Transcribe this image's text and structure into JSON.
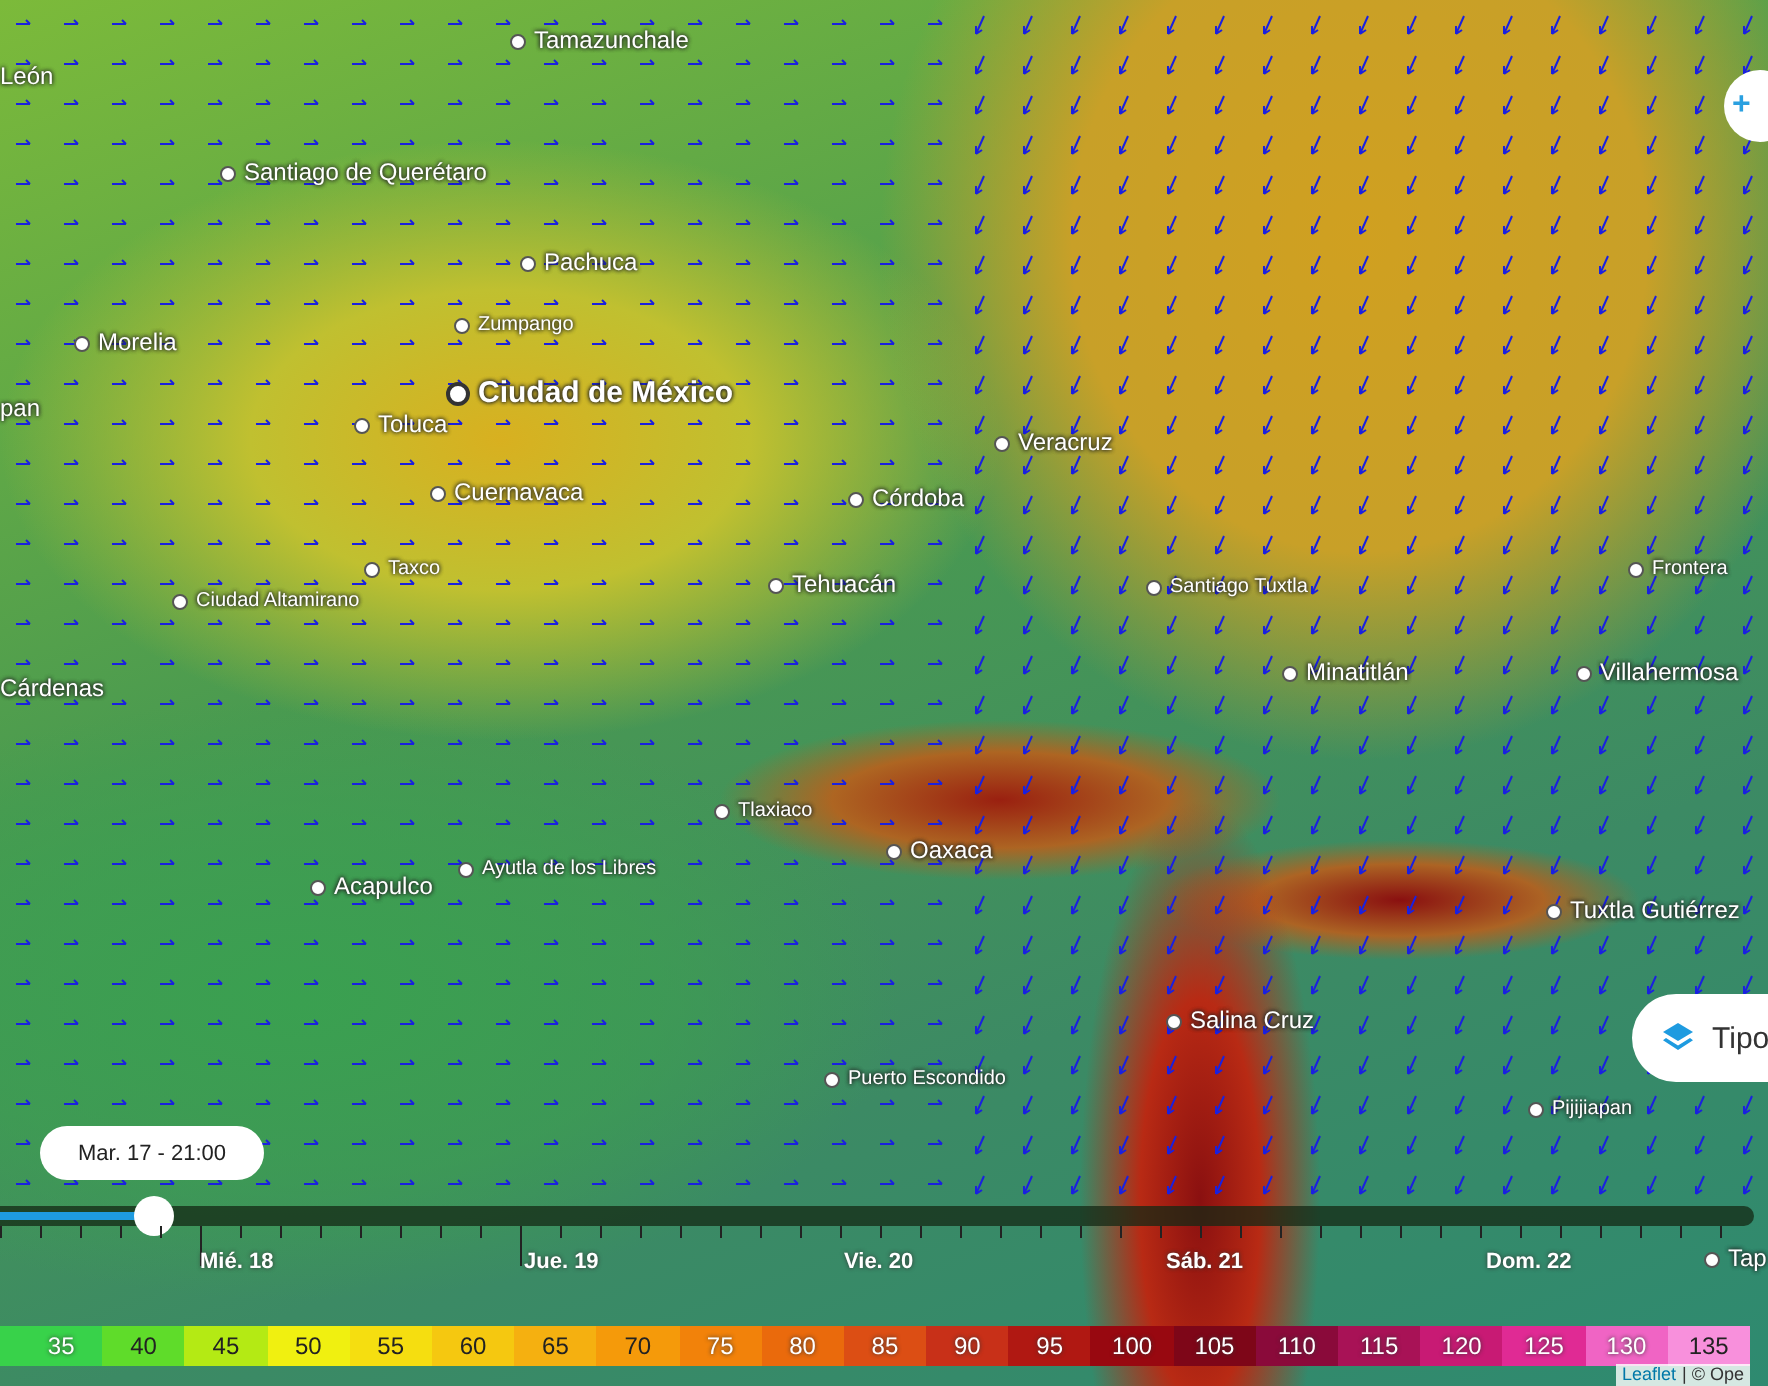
{
  "cities": [
    {
      "name": "León",
      "kind": "label"
    },
    {
      "name": "Tamazunchale",
      "kind": "town"
    },
    {
      "name": "Santiago de Querétaro",
      "kind": "town"
    },
    {
      "name": "Pachuca",
      "kind": "town"
    },
    {
      "name": "Zumpango",
      "kind": "small"
    },
    {
      "name": "Morelia",
      "kind": "town"
    },
    {
      "name": "pan",
      "kind": "label"
    },
    {
      "name": "Ciudad de México",
      "kind": "capital"
    },
    {
      "name": "Toluca",
      "kind": "town"
    },
    {
      "name": "Cuernavaca",
      "kind": "town"
    },
    {
      "name": "Taxco",
      "kind": "small"
    },
    {
      "name": "Ciudad Altamirano",
      "kind": "small"
    },
    {
      "name": "Cárdenas",
      "kind": "label"
    },
    {
      "name": "Córdoba",
      "kind": "town"
    },
    {
      "name": "Veracruz",
      "kind": "town"
    },
    {
      "name": "Tehuacán",
      "kind": "town"
    },
    {
      "name": "Santiago Tuxtla",
      "kind": "small"
    },
    {
      "name": "Frontera",
      "kind": "small"
    },
    {
      "name": "Minatitlán",
      "kind": "town"
    },
    {
      "name": "Villahermosa",
      "kind": "town"
    },
    {
      "name": "Tlaxiaco",
      "kind": "small"
    },
    {
      "name": "Oaxaca",
      "kind": "town"
    },
    {
      "name": "Acapulco",
      "kind": "town"
    },
    {
      "name": "Ayutla de los Libres",
      "kind": "small"
    },
    {
      "name": "Tuxtla Gutiérrez",
      "kind": "town"
    },
    {
      "name": "Salina Cruz",
      "kind": "town"
    },
    {
      "name": "Puerto Escondido",
      "kind": "small"
    },
    {
      "name": "Pijijiapan",
      "kind": "small"
    },
    {
      "name": "Tap",
      "kind": "town"
    }
  ],
  "zoom_button": "+",
  "layer_button": {
    "label": "Tipo"
  },
  "time_badge": "Mar. 17 - 21:00",
  "timeline": {
    "level": 0.088,
    "days": [
      "Mié. 18",
      "Jue. 19",
      "Vie. 20",
      "Sáb. 21",
      "Dom. 22"
    ]
  },
  "legend": [
    {
      "label": "35",
      "color": "#38d24a"
    },
    {
      "label": "40",
      "color": "#5fdc2a"
    },
    {
      "label": "45",
      "color": "#b4ea14"
    },
    {
      "label": "50",
      "color": "#f0f010"
    },
    {
      "label": "55",
      "color": "#f5de10"
    },
    {
      "label": "60",
      "color": "#f5c810"
    },
    {
      "label": "65",
      "color": "#f5b010"
    },
    {
      "label": "70",
      "color": "#f59a0a"
    },
    {
      "label": "75",
      "color": "#f2820a"
    },
    {
      "label": "80",
      "color": "#ea6a0c"
    },
    {
      "label": "85",
      "color": "#dc4e14"
    },
    {
      "label": "90",
      "color": "#c83018"
    },
    {
      "label": "95",
      "color": "#b01812"
    },
    {
      "label": "100",
      "color": "#980810"
    },
    {
      "label": "105",
      "color": "#7e0618"
    },
    {
      "label": "110",
      "color": "#8a0a3a"
    },
    {
      "label": "115",
      "color": "#a81256"
    },
    {
      "label": "120",
      "color": "#c81a74"
    },
    {
      "label": "125",
      "color": "#e02a94"
    },
    {
      "label": "130",
      "color": "#f064c4"
    },
    {
      "label": "135",
      "color": "#f890dc"
    }
  ],
  "attribution": {
    "link": "Leaflet",
    "rest": "| © Ope"
  }
}
